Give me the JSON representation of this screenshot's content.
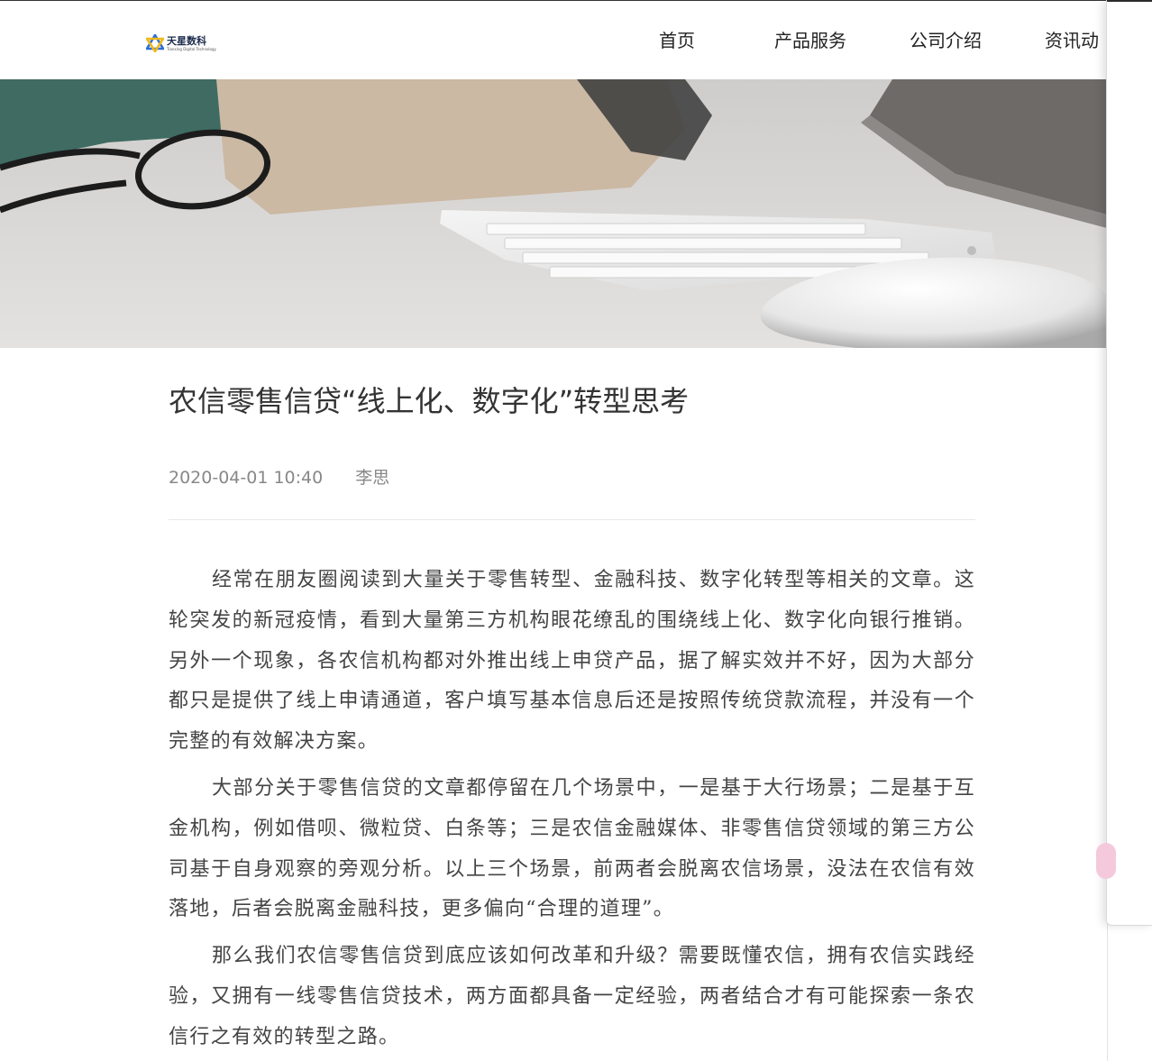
{
  "header": {
    "logo_name": "天星数科",
    "logo_tagline": "Tianxing Digital Technology",
    "nav": [
      "首页",
      "产品服务",
      "公司介绍",
      "资讯动"
    ]
  },
  "hero": {
    "image": "desk-keyboard-glasses-mouse"
  },
  "article": {
    "title": "农信零售信贷“线上化、数字化”转型思考",
    "date": "2020-04-01 10:40",
    "author": "李思",
    "paragraphs": [
      "经常在朋友圈阅读到大量关于零售转型、金融科技、数字化转型等相关的文章。这轮突发的新冠疫情，看到大量第三方机构眼花缭乱的围绕线上化、数字化向银行推销。另外一个现象，各农信机构都对外推出线上申贷产品，据了解实效并不好，因为大部分都只是提供了线上申请通道，客户填写基本信息后还是按照传统贷款流程，并没有一个完整的有效解决方案。",
      "大部分关于零售信贷的文章都停留在几个场景中，一是基于大行场景；二是基于互金机构，例如借呗、微粒贷、白条等；三是农信金融媒体、非零售信贷领域的第三方公司基于自身观察的旁观分析。以上三个场景，前两者会脱离农信场景，没法在农信有效落地，后者会脱离金融科技，更多偏向“合理的道理”。",
      "那么我们农信零售信贷到底应该如何改革和升级？需要既懂农信，拥有农信实践经验，又拥有一线零售信贷技术，两方面都具备一定经验，两者结合才有可能探索一条农信行之有效的转型之路。"
    ]
  },
  "colors": {
    "text": "#444444",
    "title": "#333333",
    "meta": "#888888",
    "logo_blue": "#2d6fd6",
    "logo_yellow": "#f0b91c"
  }
}
